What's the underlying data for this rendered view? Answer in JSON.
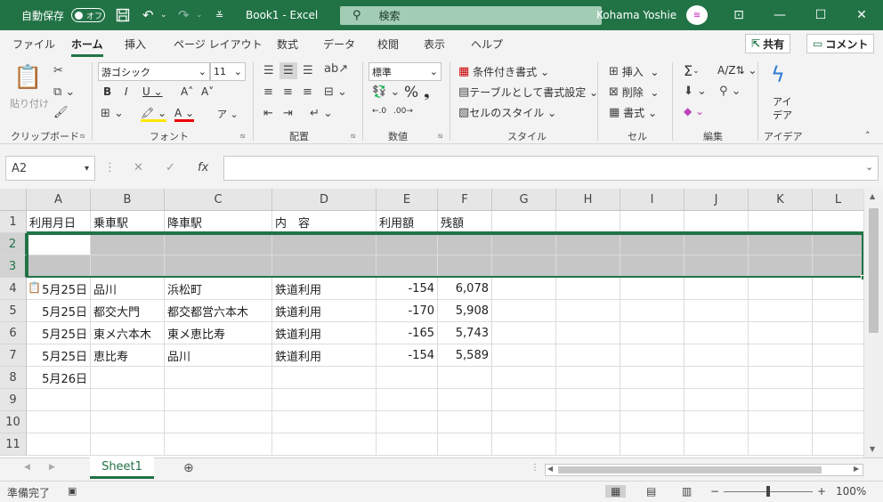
{
  "titlebar": {
    "autosave_label": "自動保存",
    "autosave_state": "オフ",
    "doc_title": "Book1  -  Excel",
    "search_placeholder": "検索",
    "user_name": "Kohama Yoshie"
  },
  "tabs": [
    "ファイル",
    "ホーム",
    "挿入",
    "ページ レイアウト",
    "数式",
    "データ",
    "校閲",
    "表示",
    "ヘルプ"
  ],
  "share_label": "共有",
  "comment_label": "コメント",
  "ribbon": {
    "clipboard": {
      "paste": "貼り付け",
      "label": "クリップボード"
    },
    "font": {
      "name": "游ゴシック",
      "size": "11",
      "label": "フォント"
    },
    "alignment": {
      "label": "配置"
    },
    "number": {
      "format": "標準",
      "label": "数値"
    },
    "styles": {
      "conditional": "条件付き書式",
      "table": "テーブルとして書式設定",
      "cell_styles": "セルのスタイル",
      "label": "スタイル"
    },
    "cells": {
      "insert": "挿入",
      "delete": "削除",
      "format": "書式",
      "label": "セル"
    },
    "editing": {
      "label": "編集"
    },
    "ideas": {
      "line1": "アイ",
      "line2": "デア",
      "label": "アイデア"
    }
  },
  "formula_bar": {
    "name_box": "A2",
    "fx": "fx",
    "value": ""
  },
  "columns": [
    "A",
    "B",
    "C",
    "D",
    "E",
    "F",
    "G",
    "H",
    "I",
    "J",
    "K",
    "L"
  ],
  "row_numbers": [
    "1",
    "2",
    "3",
    "4",
    "5",
    "6",
    "7",
    "8",
    "9",
    "10",
    "11"
  ],
  "sheet": {
    "header": [
      "利用月日",
      "乗車駅",
      "降車駅",
      "内　容",
      "利用額",
      "残額"
    ],
    "rows": [
      [
        "",
        "",
        "",
        "",
        "",
        ""
      ],
      [
        "",
        "",
        "",
        "",
        "",
        ""
      ],
      [
        "5月25日",
        "品川",
        "浜松町",
        "鉄道利用",
        "-154",
        "6,078"
      ],
      [
        "5月25日",
        "都交大門",
        "都交都営六本木",
        "鉄道利用",
        "-170",
        "5,908"
      ],
      [
        "5月25日",
        "東メ六本木",
        "東メ恵比寿",
        "鉄道利用",
        "-165",
        "5,743"
      ],
      [
        "5月25日",
        "恵比寿",
        "品川",
        "鉄道利用",
        "-154",
        "5,589"
      ],
      [
        "5月26日",
        "",
        "",
        "",
        "",
        ""
      ],
      [
        "",
        "",
        "",
        "",
        "",
        ""
      ],
      [
        "",
        "",
        "",
        "",
        "",
        ""
      ],
      [
        "",
        "",
        "",
        "",
        "",
        ""
      ]
    ]
  },
  "sheet_tab": "Sheet1",
  "status": {
    "ready": "準備完了",
    "zoom": "100%"
  },
  "colors": {
    "accent": "#217346",
    "selection": "#c6c6c6"
  }
}
